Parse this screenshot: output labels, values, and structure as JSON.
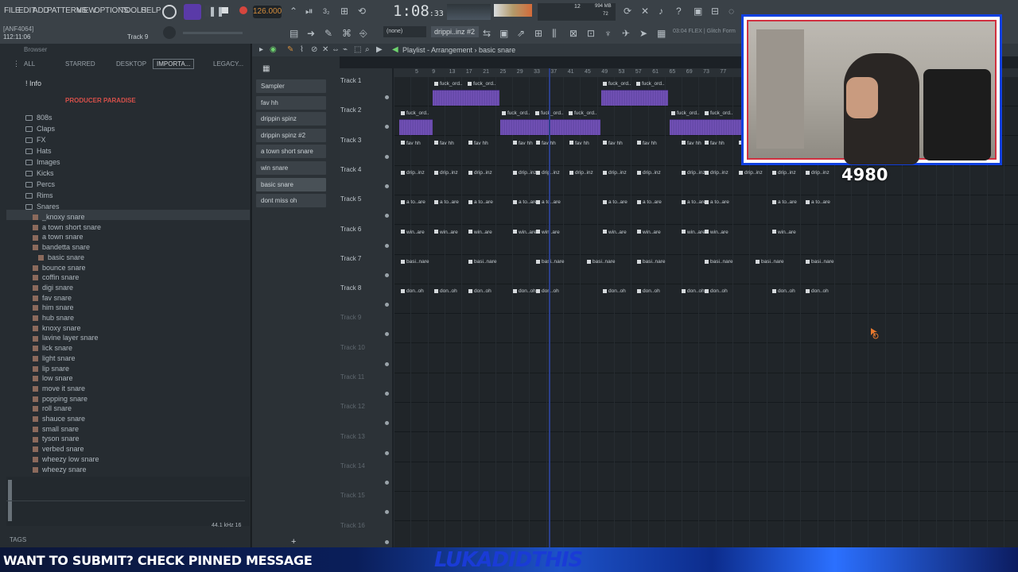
{
  "menu": [
    "FILE",
    "EDIT",
    "ADD",
    "PATTERNS",
    "VIEW",
    "OPTIONS",
    "TOOLS",
    "HELP"
  ],
  "transport": {
    "tempo": "126.000",
    "time_main": "1:08",
    "time_sub": ":33",
    "cpu": "12",
    "mem": "994 MB",
    "voices": "72"
  },
  "hint": {
    "line1": "[ANF4064]",
    "line2": "112:11:06",
    "target": "Track 9"
  },
  "toolbar": {
    "pattern_none": "(none)",
    "pattern_selected": "drippi..inz #2",
    "flex_label": "03:04  FLEX | Glitch Form"
  },
  "browser": {
    "header": "Browser",
    "tabs": [
      "ALL",
      "STARRED",
      "DESKTOP",
      "IMPORTA...",
      "LEGACY..."
    ],
    "info_label": "! Info",
    "producer": "PRODUCER PARADISE",
    "folders": [
      "808s",
      "Claps",
      "FX",
      "Hats",
      "Images",
      "Kicks",
      "Percs",
      "Rims",
      "Snares"
    ],
    "snares": [
      "_knoxy snare",
      "a town short snare",
      "a town snare",
      "bandetta snare",
      "basic snare",
      "bounce snare",
      "coffin snare",
      "digi snare",
      "fav snare",
      "him snare",
      "hub snare",
      "knoxy snare",
      "lavine layer snare",
      "lick snare",
      "light snare",
      "lip snare",
      "low snare",
      "move it snare",
      "popping snare",
      "roll snare",
      "shauce snare",
      "small snare",
      "tyson snare",
      "verbed snare",
      "wheezy low snare",
      "wheezy snare"
    ],
    "selected": "basic snare",
    "samplerate": "44.1 kHz 16",
    "tags": "TAGS"
  },
  "channels": [
    "Sampler",
    "fav hh",
    "drippin spinz",
    "drippin spinz #2",
    "a town short snare",
    "win snare",
    "basic snare",
    "dont miss oh"
  ],
  "playlist": {
    "title": "Playlist - Arrangement",
    "pattern": "basic snare",
    "tracks": [
      "Track 1",
      "Track 2",
      "Track 3",
      "Track 4",
      "Track 5",
      "Track 6",
      "Track 7",
      "Track 8",
      "Track 9",
      "Track 10",
      "Track 11",
      "Track 12",
      "Track 13",
      "Track 14",
      "Track 15",
      "Track 16"
    ],
    "ruler": [
      "5",
      "9",
      "13",
      "17",
      "21",
      "25",
      "29",
      "33",
      "37",
      "41",
      "45",
      "49",
      "53",
      "57",
      "61",
      "65",
      "69",
      "73",
      "77"
    ],
    "clip_labels": {
      "t1": "fuck_ord..",
      "t2": "fuck_ord..",
      "t3": "fav hh",
      "t4": "drip..inz",
      "t5": "a to..are",
      "t6": "win..are",
      "t7": "basi..nare",
      "t8": "don..oh"
    }
  },
  "stream": {
    "score": "4980",
    "banner_msg": "WANT TO SUBMIT? CHECK PINNED MESSAGE",
    "banner_name": "LUKADIDTHIS"
  },
  "colors": {
    "accent": "#d28c3c",
    "wave": "#8a63d2",
    "webcam_frame": "#1040e0",
    "banner": "#1d52c8"
  }
}
